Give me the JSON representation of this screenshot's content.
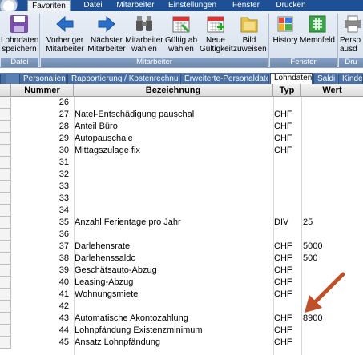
{
  "menu": {
    "tabs": [
      {
        "label": "Favoriten",
        "active": true
      },
      {
        "label": "Datei"
      },
      {
        "label": "Mitarbeiter"
      },
      {
        "label": "Einstellungen"
      },
      {
        "label": "Fenster"
      },
      {
        "label": "Drucken"
      }
    ]
  },
  "ribbon": {
    "buttons": [
      {
        "label": "Lohndaten\nspeichern",
        "icon": "save-icon"
      },
      {
        "label": "Vorheriger\nMitarbeiter",
        "icon": "arrow-left-icon"
      },
      {
        "label": "Nächster\nMitarbeiter",
        "icon": "arrow-right-icon"
      },
      {
        "label": "Mitarbeiter\nwählen",
        "icon": "binoculars-icon"
      },
      {
        "label": "Gültig ab\nwählen",
        "icon": "calendar-icon"
      },
      {
        "label": "Neue\nGültigkeit",
        "icon": "new-calendar-icon"
      },
      {
        "label": "Bild\nzuweisen",
        "icon": "image-icon"
      },
      {
        "label": "History",
        "icon": "history-icon"
      },
      {
        "label": "Memofeld",
        "icon": "memo-icon"
      },
      {
        "label": "Perso\nausd",
        "icon": "print-icon"
      }
    ],
    "groups": {
      "datei": "Datei",
      "mitarbeiter": "Mitarbeiter",
      "fenster": "Fenster",
      "drucken": "Dru"
    }
  },
  "tabs": [
    {
      "label": "Personalien"
    },
    {
      "label": "Rapportierung / Kostenrechnung"
    },
    {
      "label": "Erweiterte-Personaldaten"
    },
    {
      "label": "Lohndaten",
      "active": true
    },
    {
      "label": "Saldi"
    },
    {
      "label": "Kinde"
    }
  ],
  "table": {
    "headers": {
      "nummer": "Nummer",
      "bezeichnung": "Bezeichnung",
      "typ": "Typ",
      "wert": "Wert"
    },
    "rows": [
      {
        "n": "26",
        "b": "",
        "t": "",
        "w": ""
      },
      {
        "n": "27",
        "b": "Natel-Entschädigung pauschal",
        "t": "CHF",
        "w": ""
      },
      {
        "n": "28",
        "b": "Anteil Büro",
        "t": "CHF",
        "w": ""
      },
      {
        "n": "29",
        "b": "Autopauschale",
        "t": "CHF",
        "w": ""
      },
      {
        "n": "30",
        "b": "Mittagszulage fix",
        "t": "CHF",
        "w": ""
      },
      {
        "n": "31",
        "b": "",
        "t": "",
        "w": ""
      },
      {
        "n": "32",
        "b": "",
        "t": "",
        "w": ""
      },
      {
        "n": "33",
        "b": "",
        "t": "",
        "w": ""
      },
      {
        "n": "33",
        "b": "",
        "t": "",
        "w": ""
      },
      {
        "n": "34",
        "b": "",
        "t": "",
        "w": ""
      },
      {
        "n": "35",
        "b": "Anzahl Ferientage pro Jahr",
        "t": "DIV",
        "w": "25"
      },
      {
        "n": "36",
        "b": "",
        "t": "",
        "w": ""
      },
      {
        "n": "37",
        "b": "Darlehensrate",
        "t": "CHF",
        "w": "5000"
      },
      {
        "n": "38",
        "b": "Darlehenssaldo",
        "t": "CHF",
        "w": "500"
      },
      {
        "n": "39",
        "b": "Geschätsauto-Abzug",
        "t": "CHF",
        "w": ""
      },
      {
        "n": "40",
        "b": "Leasing-Abzug",
        "t": "CHF",
        "w": ""
      },
      {
        "n": "41",
        "b": "Wohnungsmiete",
        "t": "CHF",
        "w": ""
      },
      {
        "n": "42",
        "b": "",
        "t": "",
        "w": ""
      },
      {
        "n": "43",
        "b": "Automatische Akontozahlung",
        "t": "CHF",
        "w": "8900"
      },
      {
        "n": "44",
        "b": "Lohnpfändung Existenzminimum",
        "t": "CHF",
        "w": ""
      },
      {
        "n": "45",
        "b": "Ansatz Lohnpfändung",
        "t": "CHF",
        "w": ""
      }
    ]
  },
  "annotation": {
    "arrow_color": "#c0502a"
  }
}
